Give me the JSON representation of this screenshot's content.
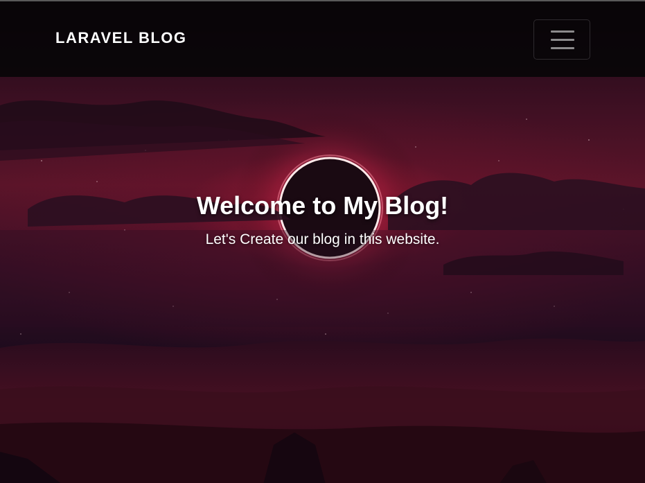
{
  "navbar": {
    "brand": "LARAVEL BLOG",
    "toggler_icon": "hamburger-menu-icon"
  },
  "hero": {
    "title": "Welcome to My Blog!",
    "subtitle": "Let's Create our blog in this website.",
    "background_image": "eclipse-over-crimson-clouds",
    "colors": {
      "navbar_bg": "#080508",
      "text": "#ffffff",
      "accent_red": "#8a1a34"
    }
  }
}
